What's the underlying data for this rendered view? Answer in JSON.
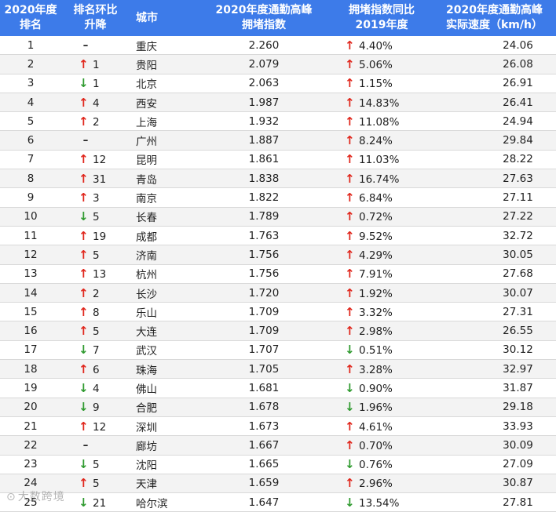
{
  "headers": {
    "rank": "2020年度\n排名",
    "change": "排名环比\n升降",
    "city": "城市",
    "index": "2020年度通勤高峰\n拥堵指数",
    "yoy": "拥堵指数同比\n2019年度",
    "speed": "2020年度通勤高峰\n实际速度（km/h）"
  },
  "colors": {
    "header_bg": "#3d7be9",
    "up": "#e0261c",
    "down": "#2f9a2f"
  },
  "rows": [
    {
      "rank": "1",
      "dir": "none",
      "chg": "",
      "city": "重庆",
      "index": "2.260",
      "ydir": "up",
      "yoy": "4.40%",
      "speed": "24.06"
    },
    {
      "rank": "2",
      "dir": "up",
      "chg": "1",
      "city": "贵阳",
      "index": "2.079",
      "ydir": "up",
      "yoy": "5.06%",
      "speed": "26.08"
    },
    {
      "rank": "3",
      "dir": "down",
      "chg": "1",
      "city": "北京",
      "index": "2.063",
      "ydir": "up",
      "yoy": "1.15%",
      "speed": "26.91"
    },
    {
      "rank": "4",
      "dir": "up",
      "chg": "4",
      "city": "西安",
      "index": "1.987",
      "ydir": "up",
      "yoy": "14.83%",
      "speed": "26.41"
    },
    {
      "rank": "5",
      "dir": "up",
      "chg": "2",
      "city": "上海",
      "index": "1.932",
      "ydir": "up",
      "yoy": "11.08%",
      "speed": "24.94"
    },
    {
      "rank": "6",
      "dir": "none",
      "chg": "",
      "city": "广州",
      "index": "1.887",
      "ydir": "up",
      "yoy": "8.24%",
      "speed": "29.84"
    },
    {
      "rank": "7",
      "dir": "up",
      "chg": "12",
      "city": "昆明",
      "index": "1.861",
      "ydir": "up",
      "yoy": "11.03%",
      "speed": "28.22"
    },
    {
      "rank": "8",
      "dir": "up",
      "chg": "31",
      "city": "青岛",
      "index": "1.838",
      "ydir": "up",
      "yoy": "16.74%",
      "speed": "27.63"
    },
    {
      "rank": "9",
      "dir": "up",
      "chg": "3",
      "city": "南京",
      "index": "1.822",
      "ydir": "up",
      "yoy": "6.84%",
      "speed": "27.11"
    },
    {
      "rank": "10",
      "dir": "down",
      "chg": "5",
      "city": "长春",
      "index": "1.789",
      "ydir": "up",
      "yoy": "0.72%",
      "speed": "27.22"
    },
    {
      "rank": "11",
      "dir": "up",
      "chg": "19",
      "city": "成都",
      "index": "1.763",
      "ydir": "up",
      "yoy": "9.52%",
      "speed": "32.72"
    },
    {
      "rank": "12",
      "dir": "up",
      "chg": "5",
      "city": "济南",
      "index": "1.756",
      "ydir": "up",
      "yoy": "4.29%",
      "speed": "30.05"
    },
    {
      "rank": "13",
      "dir": "up",
      "chg": "13",
      "city": "杭州",
      "index": "1.756",
      "ydir": "up",
      "yoy": "7.91%",
      "speed": "27.68"
    },
    {
      "rank": "14",
      "dir": "up",
      "chg": "2",
      "city": "长沙",
      "index": "1.720",
      "ydir": "up",
      "yoy": "1.92%",
      "speed": "30.07"
    },
    {
      "rank": "15",
      "dir": "up",
      "chg": "8",
      "city": "乐山",
      "index": "1.709",
      "ydir": "up",
      "yoy": "3.32%",
      "speed": "27.31"
    },
    {
      "rank": "16",
      "dir": "up",
      "chg": "5",
      "city": "大连",
      "index": "1.709",
      "ydir": "up",
      "yoy": "2.98%",
      "speed": "26.55"
    },
    {
      "rank": "17",
      "dir": "down",
      "chg": "7",
      "city": "武汉",
      "index": "1.707",
      "ydir": "down",
      "yoy": "0.51%",
      "speed": "30.12"
    },
    {
      "rank": "18",
      "dir": "up",
      "chg": "6",
      "city": "珠海",
      "index": "1.705",
      "ydir": "up",
      "yoy": "3.28%",
      "speed": "32.97"
    },
    {
      "rank": "19",
      "dir": "down",
      "chg": "4",
      "city": "佛山",
      "index": "1.681",
      "ydir": "down",
      "yoy": "0.90%",
      "speed": "31.87"
    },
    {
      "rank": "20",
      "dir": "down",
      "chg": "9",
      "city": "合肥",
      "index": "1.678",
      "ydir": "down",
      "yoy": "1.96%",
      "speed": "29.18"
    },
    {
      "rank": "21",
      "dir": "up",
      "chg": "12",
      "city": "深圳",
      "index": "1.673",
      "ydir": "up",
      "yoy": "4.61%",
      "speed": "33.93"
    },
    {
      "rank": "22",
      "dir": "none",
      "chg": "",
      "city": "廊坊",
      "index": "1.667",
      "ydir": "up",
      "yoy": "0.70%",
      "speed": "30.09"
    },
    {
      "rank": "23",
      "dir": "down",
      "chg": "5",
      "city": "沈阳",
      "index": "1.665",
      "ydir": "down",
      "yoy": "0.76%",
      "speed": "27.09"
    },
    {
      "rank": "24",
      "dir": "up",
      "chg": "5",
      "city": "天津",
      "index": "1.659",
      "ydir": "up",
      "yoy": "2.96%",
      "speed": "30.87"
    },
    {
      "rank": "25",
      "dir": "down",
      "chg": "21",
      "city": "哈尔滨",
      "index": "1.647",
      "ydir": "down",
      "yoy": "13.54%",
      "speed": "27.81"
    }
  ],
  "watermark": "大数跨境"
}
